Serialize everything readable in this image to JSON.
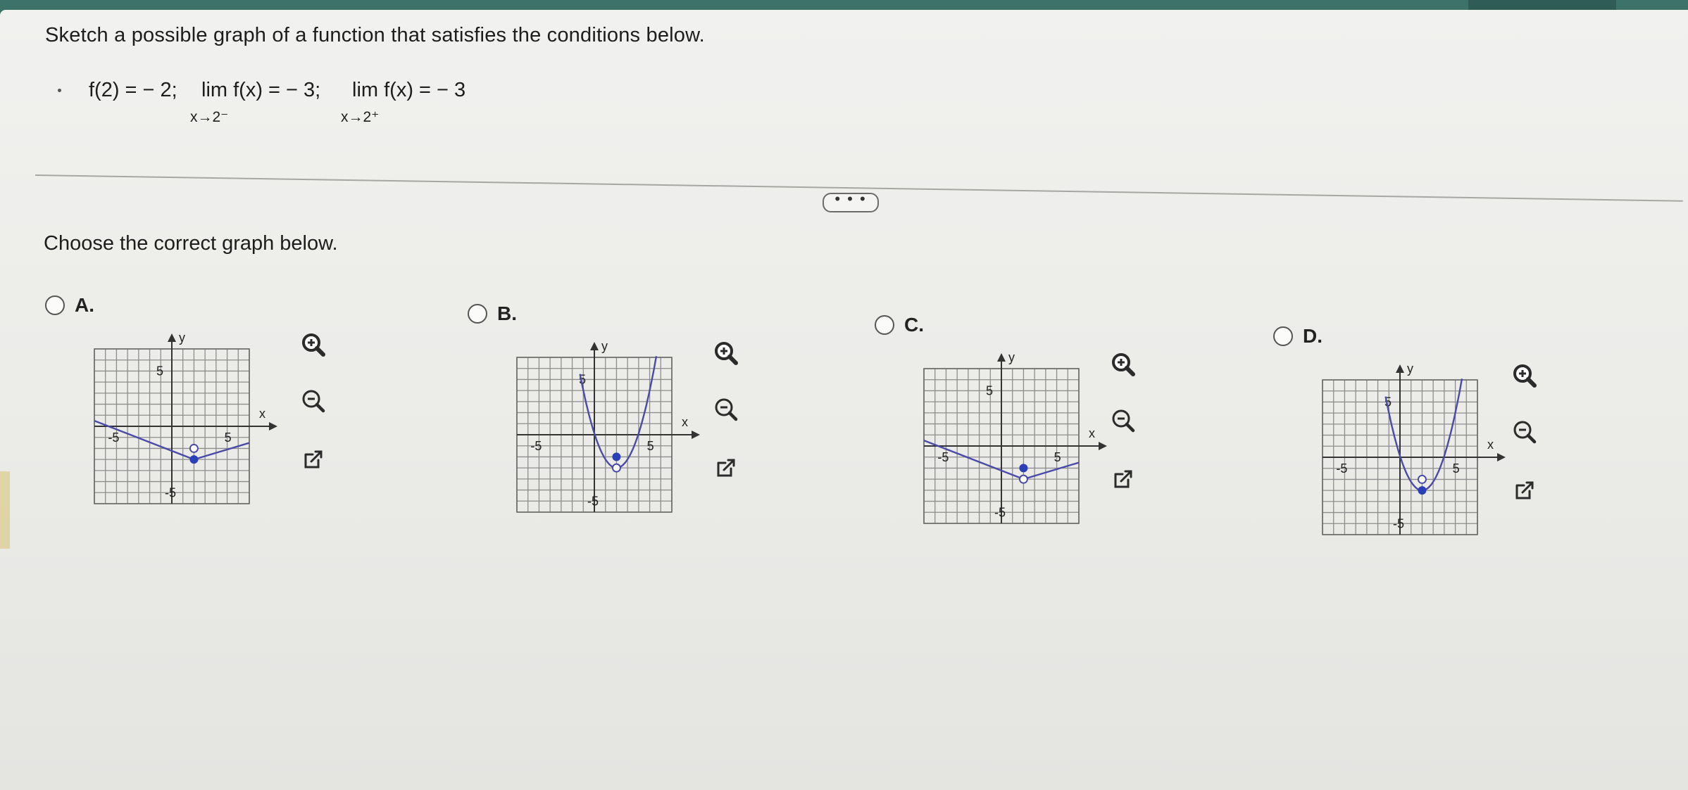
{
  "prompt": "Sketch a possible graph of a function that satisfies the conditions below.",
  "conditions": {
    "f_def": "f(2) = − 2;",
    "lim1": "lim f(x) = − 3;",
    "lim1_sub": "x→2⁻",
    "lim2": "lim f(x) = − 3",
    "lim2_sub": "x→2⁺"
  },
  "more_label": "• • •",
  "choose": "Choose the correct graph below.",
  "axis_labels": {
    "x": "x",
    "y": "y",
    "pos": "5",
    "neg": "-5"
  },
  "options": [
    {
      "letter": "A.",
      "shape": "line-v",
      "filled": [
        2,
        -3
      ],
      "open": [
        2,
        -2
      ]
    },
    {
      "letter": "B.",
      "shape": "parabola",
      "filled": [
        2,
        -2
      ],
      "open": [
        2,
        -3
      ]
    },
    {
      "letter": "C.",
      "shape": "line-v",
      "filled": [
        2,
        -2
      ],
      "open": [
        2,
        -3
      ]
    },
    {
      "letter": "D.",
      "shape": "parabola",
      "filled": [
        2,
        -3
      ],
      "open": [
        2,
        -2
      ]
    }
  ],
  "icons": [
    "zoom-in-icon",
    "zoom-out-icon",
    "open-new-window-icon"
  ],
  "colors": {
    "curve": "#4a4aa8",
    "dot": "#2a3fb8",
    "grid": "#8d8d8d",
    "accent": "#3d7268"
  }
}
